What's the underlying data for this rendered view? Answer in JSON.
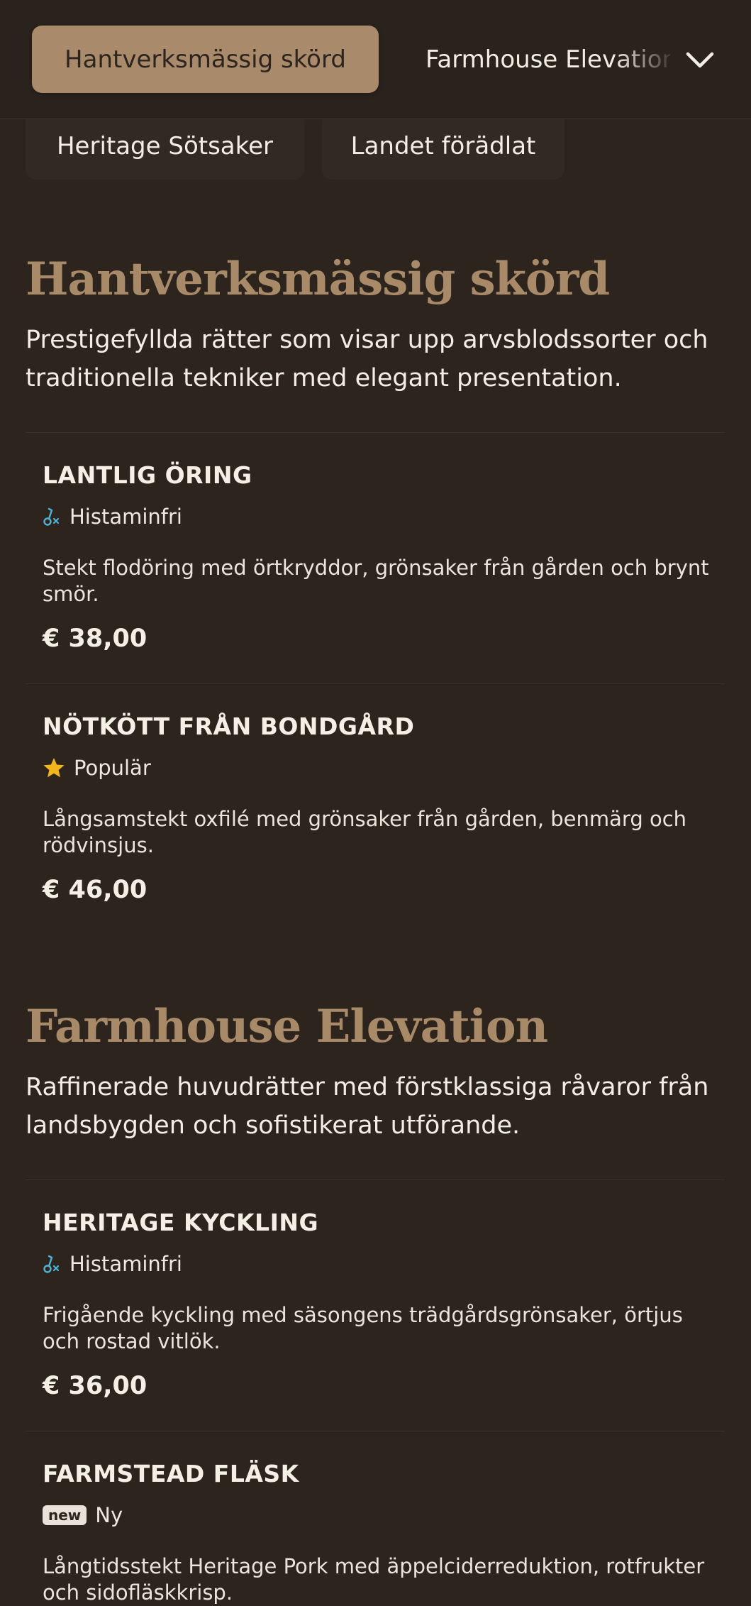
{
  "nav": {
    "active_tab": "Hantverksmässig skörd",
    "next_tab": "Farmhouse Elevation",
    "row2_tabs": [
      "Heritage Sötsaker",
      "Landet förädlat"
    ]
  },
  "sections": [
    {
      "title": "Hantverksmässig skörd",
      "description": "Prestigefyllda rätter som visar upp arvsblodssorter och traditionella tekniker med elegant presentation.",
      "items": [
        {
          "name": "LANTLIG ÖRING",
          "tag_icon": "histamine-free-icon",
          "tag": "Histaminfri",
          "description": "Stekt flodöring med örtkryddor, grönsaker från gården och brynt smör.",
          "price": "€ 38,00"
        },
        {
          "name": "NÖTKÖTT FRÅN BONDGÅRD",
          "tag_icon": "star-icon",
          "tag": "Populär",
          "description": "Långsamstekt oxfilé med grönsaker från gården, benmärg och rödvinsjus.",
          "price": "€ 46,00"
        }
      ]
    },
    {
      "title": "Farmhouse Elevation",
      "description": "Raffinerade huvudrätter med förstklassiga råvaror från landsbygden och sofistikerat utförande.",
      "items": [
        {
          "name": "HERITAGE KYCKLING",
          "tag_icon": "histamine-free-icon",
          "tag": "Histaminfri",
          "description": "Frigående kyckling med säsongens trädgårdsgrönsaker, örtjus och rostad vitlök.",
          "price": "€ 36,00"
        },
        {
          "name": "FARMSTEAD FLÄSK",
          "tag_icon": "new-badge-icon",
          "tag_badge": "new",
          "tag": "Ny",
          "description": "Långtidsstekt Heritage Pork med äppelciderreduktion, rotfrukter och sidofläskkrisp."
        }
      ]
    }
  ],
  "colors": {
    "background": "#2c241d",
    "accent": "#a98a6b",
    "histamine_icon": "#4fb3d9",
    "star_icon": "#f2b61c"
  }
}
